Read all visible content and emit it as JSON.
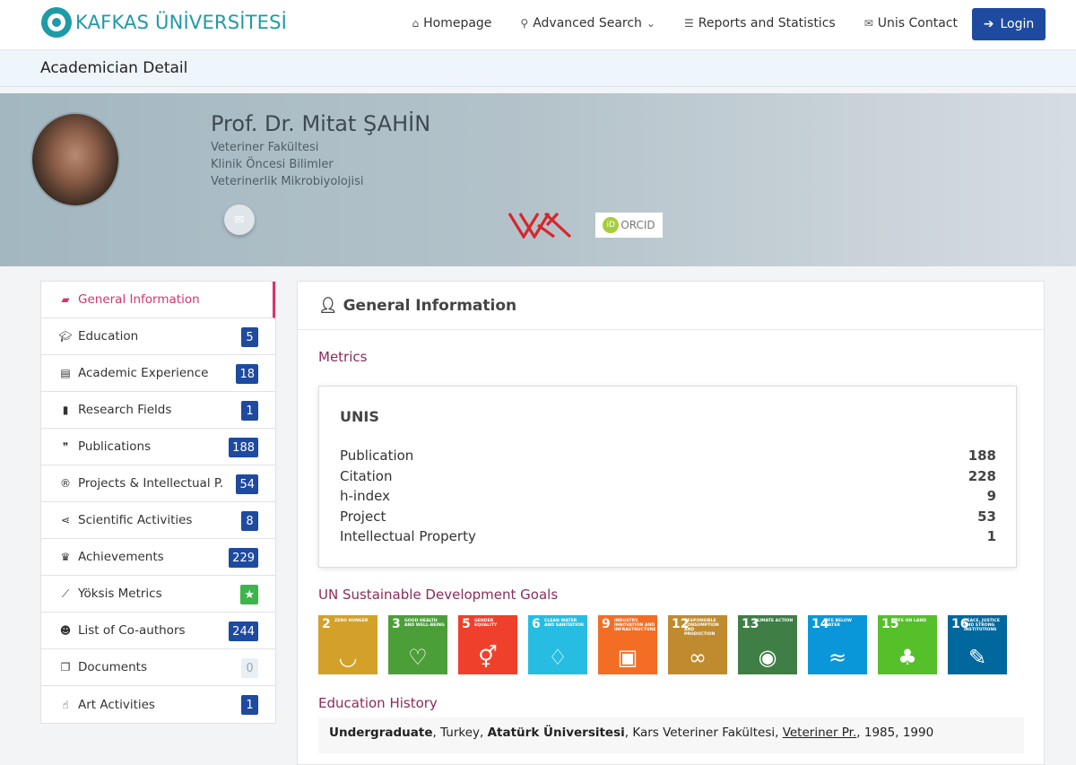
{
  "nav": {
    "brand": "KAFKAS ÜNİVERSİTESİ",
    "links": [
      {
        "label": "Homepage",
        "icon": "home-icon"
      },
      {
        "label": "Advanced Search",
        "icon": "search-icon"
      },
      {
        "label": "Reports and Statistics",
        "icon": "list-icon"
      },
      {
        "label": "Unis Contact",
        "icon": "envelope-icon"
      }
    ],
    "login": "Login"
  },
  "page_title": "Academician Detail",
  "profile": {
    "name": "Prof. Dr. Mitat ŞAHİN",
    "faculty": "Veteriner Fakültesi",
    "department": "Klinik Öncesi Bilimler",
    "division": "Veterinerlik Mikrobiyolojisi",
    "orcid_label": "ORCID",
    "orcid_id": "iD"
  },
  "sidebar": [
    {
      "label": "General Information",
      "icon": "book-icon",
      "badge": ""
    },
    {
      "label": "Education",
      "icon": "graduation-cap-icon",
      "badge": "5"
    },
    {
      "label": "Academic Experience",
      "icon": "newspaper-icon",
      "badge": "18"
    },
    {
      "label": "Research Fields",
      "icon": "bookmark-icon",
      "badge": "1"
    },
    {
      "label": "Publications",
      "icon": "quote-icon",
      "badge": "188"
    },
    {
      "label": "Projects & Intellectual P.",
      "icon": "registered-icon",
      "badge": "54"
    },
    {
      "label": "Scientific Activities",
      "icon": "share-icon",
      "badge": "8"
    },
    {
      "label": "Achievements",
      "icon": "trophy-icon",
      "badge": "229"
    },
    {
      "label": "Yöksis Metrics",
      "icon": "line-chart-icon",
      "badge": "★"
    },
    {
      "label": "List of Co-authors",
      "icon": "users-icon",
      "badge": "244"
    },
    {
      "label": "Documents",
      "icon": "documents-icon",
      "badge": "0"
    },
    {
      "label": "Art Activities",
      "icon": "hand-pointer-icon",
      "badge": "1"
    }
  ],
  "main": {
    "header": "General Information",
    "metrics_heading": "Metrics",
    "metrics_card_title": "UNIS",
    "metrics": [
      {
        "label": "Publication",
        "value": "188"
      },
      {
        "label": "Citation",
        "value": "228"
      },
      {
        "label": "h-index",
        "value": "9"
      },
      {
        "label": "Project",
        "value": "53"
      },
      {
        "label": "Intellectual Property",
        "value": "1"
      }
    ],
    "sdg_heading": "UN Sustainable Development Goals",
    "sdgs": [
      {
        "num": "2",
        "text": "ZERO HUNGER",
        "color": "#d3a029",
        "symbol": "◡"
      },
      {
        "num": "3",
        "text": "GOOD HEALTH AND WELL-BEING",
        "color": "#4c9f38",
        "symbol": "♡"
      },
      {
        "num": "5",
        "text": "GENDER EQUALITY",
        "color": "#ef402b",
        "symbol": "⚥"
      },
      {
        "num": "6",
        "text": "CLEAN WATER AND SANITATION",
        "color": "#27bde2",
        "symbol": "♢"
      },
      {
        "num": "9",
        "text": "INDUSTRY, INNOVATION AND INFRASTRUCTURE",
        "color": "#f36d25",
        "symbol": "▣"
      },
      {
        "num": "12",
        "text": "RESPONSIBLE CONSUMPTION AND PRODUCTION",
        "color": "#bf8b2e",
        "symbol": "∞"
      },
      {
        "num": "13",
        "text": "CLIMATE ACTION",
        "color": "#3f7e44",
        "symbol": "◉"
      },
      {
        "num": "14",
        "text": "LIFE BELOW WATER",
        "color": "#0a97d9",
        "symbol": "≈"
      },
      {
        "num": "15",
        "text": "LIFE ON LAND",
        "color": "#56c02b",
        "symbol": "♣"
      },
      {
        "num": "16",
        "text": "PEACE, JUSTICE AND STRONG INSTITUTIONS",
        "color": "#00689d",
        "symbol": "✎"
      }
    ],
    "education_heading": "Education History",
    "education": {
      "degree": "Undergraduate",
      "country": ", Turkey, ",
      "university": "Atatürk Üniversitesi",
      "faculty": ", Kars Veteriner Fakültesi, ",
      "program": "Veteriner Pr.",
      "years": ", 1985, 1990"
    }
  }
}
